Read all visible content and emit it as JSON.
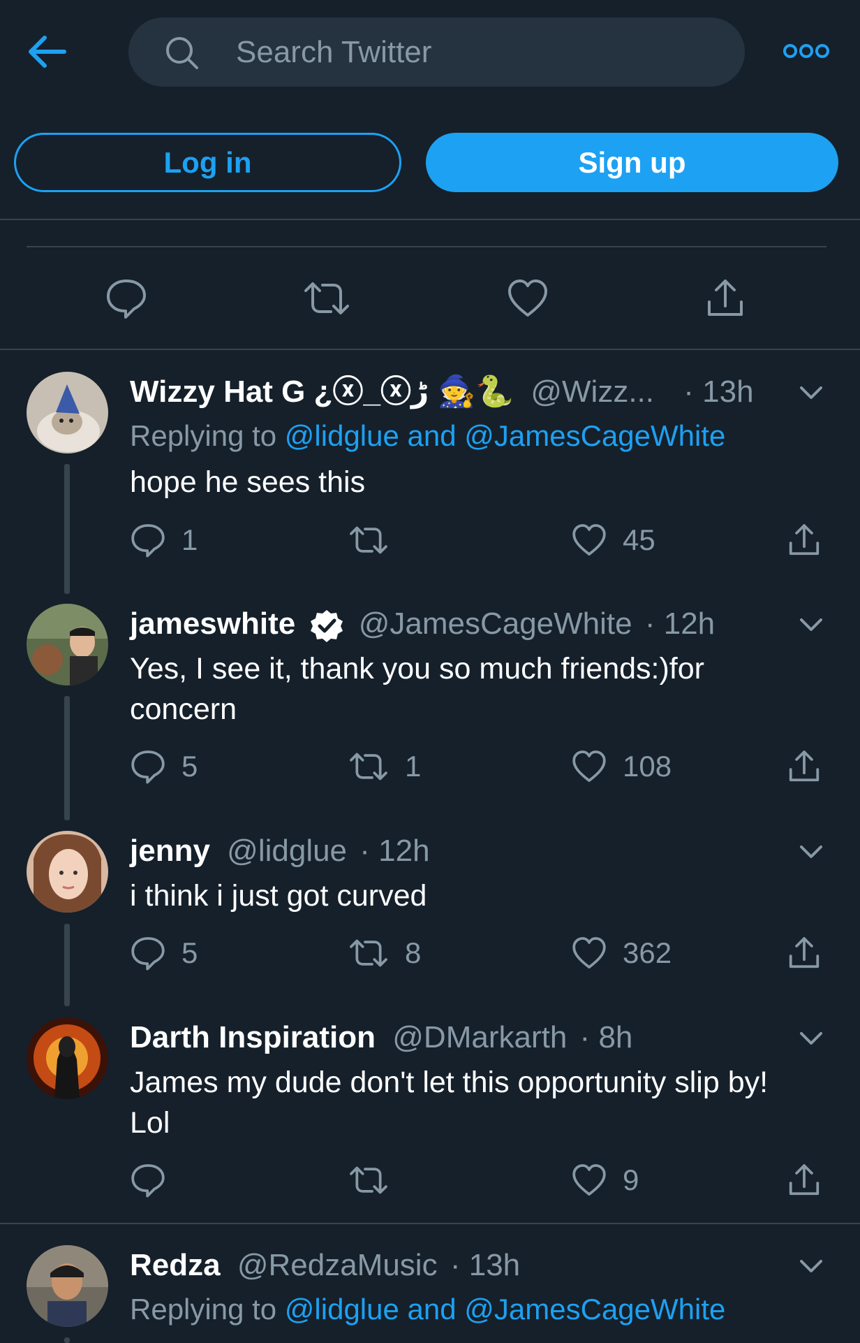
{
  "search": {
    "placeholder": "Search Twitter"
  },
  "auth": {
    "login_label": "Log in",
    "signup_label": "Sign up"
  },
  "colors": {
    "background": "#15202b",
    "accent": "#1da1f2",
    "muted": "#8899a6",
    "divider": "#38444d"
  },
  "tweets": [
    {
      "name": "Wizzy Hat G ¿ⓧ_ⓧﮌ 🧙🐍",
      "handle": "@Wizz...",
      "time": "13h",
      "replying_prefix": "Replying to ",
      "replying_mentions": "@lidglue and @JamesCageWhite",
      "text": "hope he sees this",
      "replies": "1",
      "retweets": "",
      "likes": "45"
    },
    {
      "name": "jameswhite",
      "verified": true,
      "handle": "@JamesCageWhite",
      "time": "12h",
      "text": "Yes, I see it, thank you so much friends:)for concern",
      "replies": "5",
      "retweets": "1",
      "likes": "108"
    },
    {
      "name": "jenny",
      "handle": "@lidglue",
      "time": "12h",
      "text": "i think i just got curved",
      "replies": "5",
      "retweets": "8",
      "likes": "362"
    },
    {
      "name": "Darth Inspiration",
      "handle": "@DMarkarth",
      "time": "8h",
      "text": "James my dude don't let this opportunity slip by! Lol",
      "replies": "",
      "retweets": "",
      "likes": "9"
    },
    {
      "name": "Redza",
      "handle": "@RedzaMusic",
      "time": "13h",
      "replying_prefix": "Replying to ",
      "replying_mentions": "@lidglue and @JamesCageWhite"
    }
  ],
  "separators": {
    "dot": "·"
  }
}
